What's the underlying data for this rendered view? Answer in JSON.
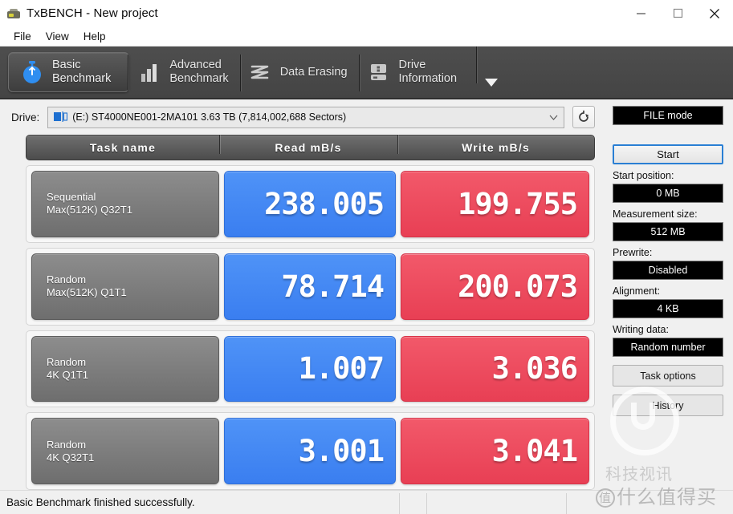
{
  "window": {
    "title": "TxBENCH - New project",
    "icon": "txbench-app-icon",
    "controls": {
      "minimize": "minimize-icon",
      "maximize": "maximize-icon",
      "close": "close-icon"
    }
  },
  "menubar": {
    "items": [
      {
        "label": "File"
      },
      {
        "label": "View"
      },
      {
        "label": "Help"
      }
    ]
  },
  "tabs": {
    "items": [
      {
        "label": "Basic\nBenchmark",
        "icon": "stopwatch-icon",
        "active": true
      },
      {
        "label": "Advanced\nBenchmark",
        "icon": "bar-chart-icon",
        "active": false
      },
      {
        "label": "Data Erasing",
        "icon": "eraser-wave-icon",
        "active": false
      },
      {
        "label": "Drive\nInformation",
        "icon": "drive-info-icon",
        "active": false
      }
    ],
    "overflow_icon": "chevron-down-icon"
  },
  "drive": {
    "label": "Drive:",
    "icon": "drive-icon",
    "selected": "(E:) ST4000NE001-2MA101  3.63 TB (7,814,002,688 Sectors)",
    "dropdown_icon": "chevron-down-icon",
    "refresh_icon": "refresh-icon"
  },
  "results": {
    "columns": [
      "Task name",
      "Read mB/s",
      "Write mB/s"
    ],
    "rows": [
      {
        "task_line1": "Sequential",
        "task_line2": "Max(512K) Q32T1",
        "read": "238.005",
        "write": "199.755"
      },
      {
        "task_line1": "Random",
        "task_line2": "Max(512K) Q1T1",
        "read": "78.714",
        "write": "200.073"
      },
      {
        "task_line1": "Random",
        "task_line2": "4K Q1T1",
        "read": "1.007",
        "write": "3.036"
      },
      {
        "task_line1": "Random",
        "task_line2": "4K Q32T1",
        "read": "3.001",
        "write": "3.041"
      }
    ]
  },
  "sidebar": {
    "mode": "FILE mode",
    "start_button": "Start",
    "fields": [
      {
        "label": "Start position:",
        "value": "0 MB"
      },
      {
        "label": "Measurement size:",
        "value": "512 MB"
      },
      {
        "label": "Prewrite:",
        "value": "Disabled"
      },
      {
        "label": "Alignment:",
        "value": "4 KB"
      },
      {
        "label": "Writing data:",
        "value": "Random number"
      }
    ],
    "buttons": [
      {
        "label": "Task options"
      },
      {
        "label": "History"
      }
    ]
  },
  "statusbar": {
    "message": "Basic Benchmark finished successfully."
  },
  "watermark": {
    "line1": "科技视讯",
    "line2_circle": "值",
    "line2": "什么值得买"
  },
  "colors": {
    "read_accent": "#4f93f7",
    "write_accent": "#f2596a",
    "tabstrip_bg": "#4a4a4a",
    "start_border": "#2a7fd4",
    "display_bg": "#000000"
  }
}
